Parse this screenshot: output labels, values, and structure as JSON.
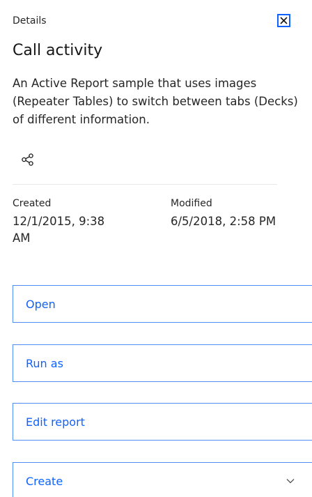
{
  "header": {
    "label": "Details",
    "close_icon": "close-icon"
  },
  "title": "Call activity",
  "description": "An Active Report sample that uses images (Repeater Tables) to switch between tabs (Decks) of different information.",
  "share_icon": "share-icon",
  "metadata": {
    "created": {
      "label": "Created",
      "value": "12/1/2015, 9:38 AM"
    },
    "modified": {
      "label": "Modified",
      "value": "6/5/2018, 2:58 PM"
    }
  },
  "actions": {
    "open_label": "Open",
    "run_as_label": "Run as",
    "edit_report_label": "Edit report",
    "create_label": "Create"
  },
  "colors": {
    "accent": "#0f62fe",
    "button_border": "#4f8df5"
  }
}
